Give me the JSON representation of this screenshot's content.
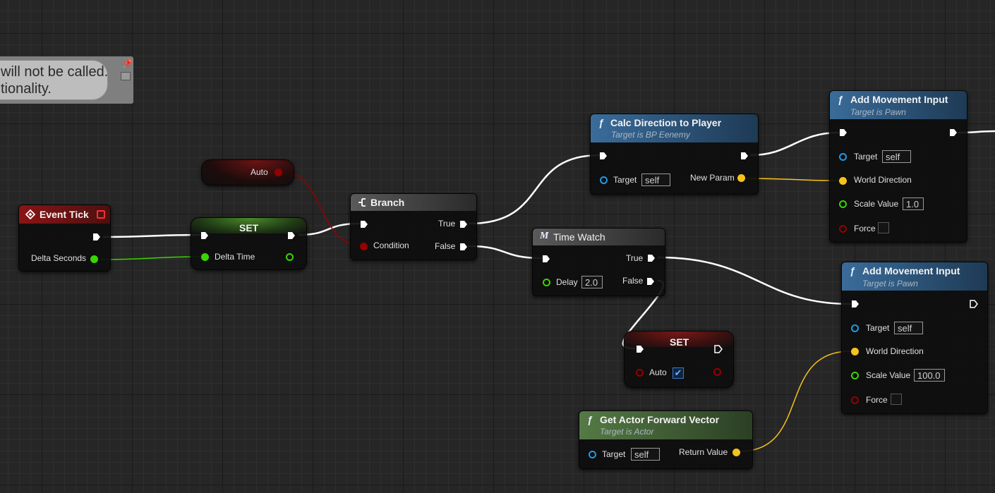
{
  "comment": {
    "line1": "will not be called.",
    "line2": "tionality."
  },
  "colors": {
    "exec": "#ffffff",
    "bool": "#950000",
    "float": "#38d500",
    "vector": "#f7c21a",
    "object": "#1d9bea",
    "event_header": "#7b1414",
    "function_header": "#315e86",
    "pure_function_header": "#4c6e3b"
  },
  "event_tick": {
    "title": "Event Tick",
    "delta_label": "Delta Seconds"
  },
  "set_delta": {
    "title": "SET",
    "pin_label": "Delta Time"
  },
  "auto_getter": {
    "label": "Auto"
  },
  "branch": {
    "title": "Branch",
    "condition": "Condition",
    "true_label": "True",
    "false_label": "False"
  },
  "calc_direction": {
    "title": "Calc Direction to Player",
    "subtitle": "Target is BP Eenemy",
    "target_label": "Target",
    "target_value": "self",
    "out_label": "New Param"
  },
  "time_watch": {
    "title": "Time Watch",
    "delay_label": "Delay",
    "delay_value": "2.0",
    "true_label": "True",
    "false_label": "False"
  },
  "set_auto": {
    "title": "SET",
    "pin_label": "Auto",
    "checked": true
  },
  "add_movement_1": {
    "title": "Add Movement Input",
    "subtitle": "Target is Pawn",
    "target_label": "Target",
    "target_value": "self",
    "direction_label": "World Direction",
    "scale_label": "Scale Value",
    "scale_value": "1.0",
    "force_label": "Force"
  },
  "add_movement_2": {
    "title": "Add Movement Input",
    "subtitle": "Target is Pawn",
    "target_label": "Target",
    "target_value": "self",
    "direction_label": "World Direction",
    "scale_label": "Scale Value",
    "scale_value": "100.0",
    "force_label": "Force"
  },
  "get_forward": {
    "title": "Get Actor Forward Vector",
    "subtitle": "Target is Actor",
    "target_label": "Target",
    "target_value": "self",
    "out_label": "Return Value"
  }
}
